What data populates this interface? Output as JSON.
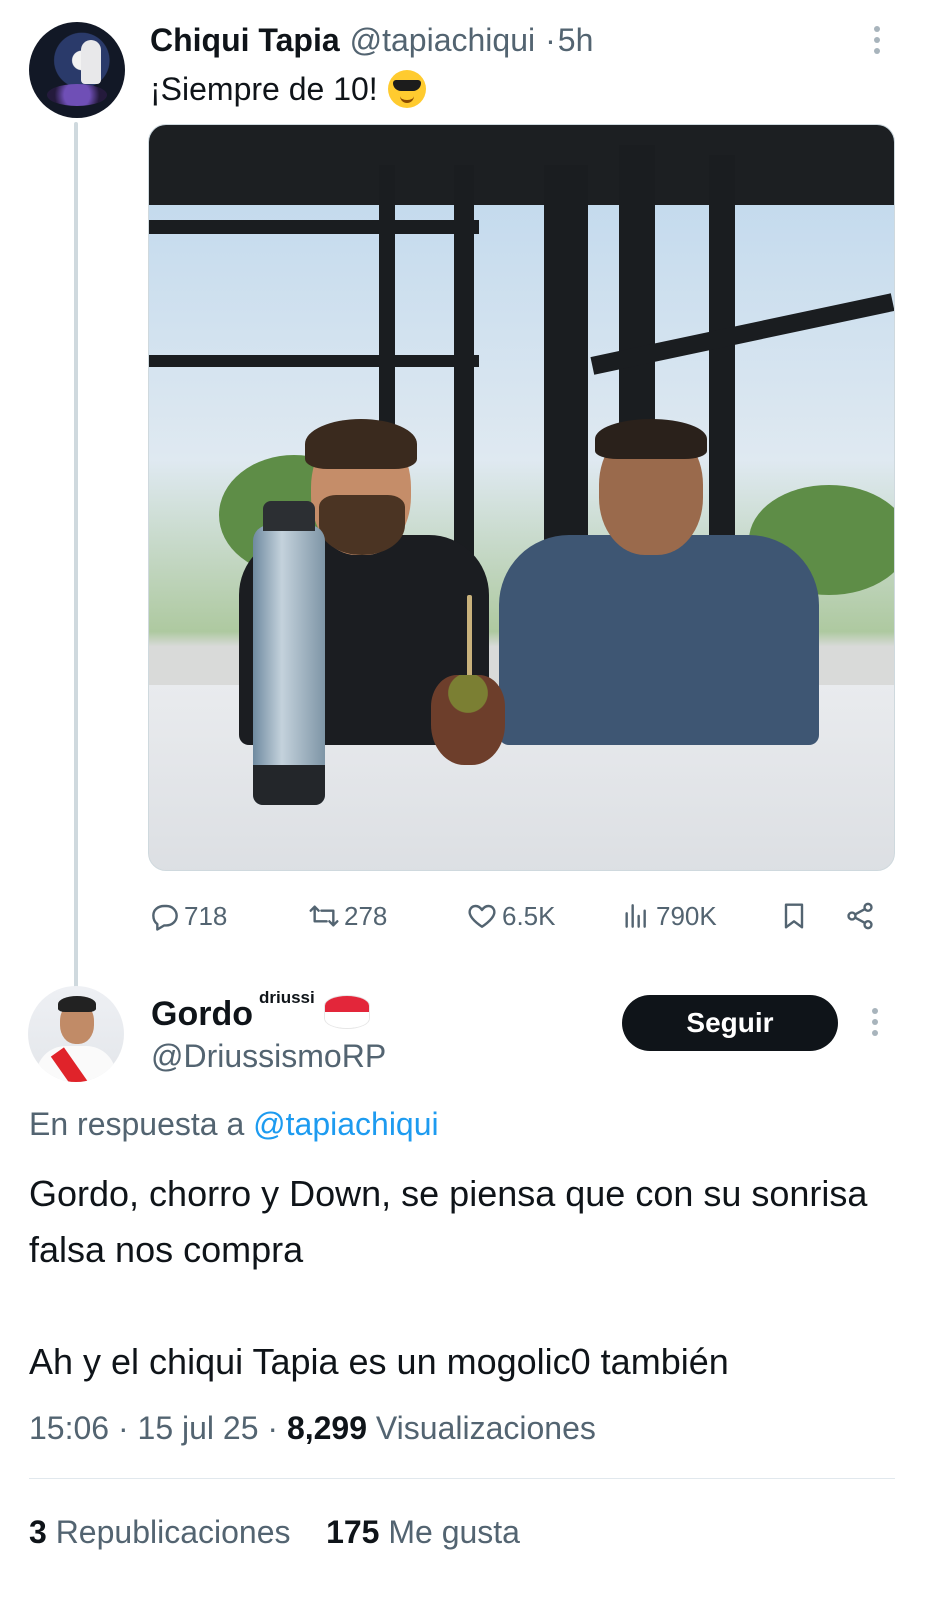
{
  "parent_tweet": {
    "author_name": "Chiqui Tapia",
    "author_handle": "@tapiachiqui",
    "separator": "·",
    "time_ago": "5h",
    "text": "¡Siempre de 10!",
    "emoji": "smiling-face-with-sunglasses",
    "actions": {
      "replies": "718",
      "reposts": "278",
      "likes": "6.5K",
      "views": "790K"
    }
  },
  "reply_tweet": {
    "author_name": "Gordo",
    "author_name_suffix": "driussi",
    "author_flag": "red-white-flag",
    "author_handle": "@DriussismoRP",
    "follow_label": "Seguir",
    "replying_to_prefix": "En respuesta a",
    "replying_to_handle": "@tapiachiqui",
    "body_paragraph_1": "Gordo, chorro y Down, se piensa que con su sonrisa falsa nos compra",
    "body_paragraph_2": "Ah y el chiqui Tapia es un mogolic0 también",
    "time": "15:06",
    "date": "15 jul 25",
    "dot": "·",
    "views_count": "8,299",
    "views_label": "Visualizaciones",
    "reposts_count": "3",
    "reposts_label": "Republicaciones",
    "likes_count": "175",
    "likes_label": "Me gusta"
  },
  "colors": {
    "text_primary": "#0f1419",
    "text_secondary": "#536471",
    "link": "#1d9bf0",
    "thread_line": "#cfd9de",
    "button_bg": "#0f1419"
  }
}
